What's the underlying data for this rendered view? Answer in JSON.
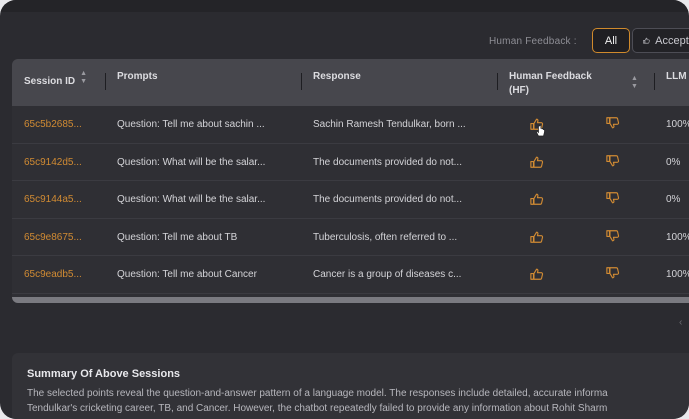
{
  "filter": {
    "label": "Human Feedback :",
    "options": [
      "All",
      "Accepted"
    ]
  },
  "table": {
    "headers": {
      "session_id": "Session ID",
      "prompts": "Prompts",
      "response": "Response",
      "human_feedback_line1": "Human Feedback",
      "human_feedback_line2": "(HF)",
      "llm": "LLM"
    },
    "rows": [
      {
        "session_id": "65c5b2685...",
        "prompt": "Question: Tell me about sachin ...",
        "response": "Sachin Ramesh Tendulkar, born ...",
        "llm": "100%"
      },
      {
        "session_id": "65c9142d5...",
        "prompt": "Question: What will be the salar...",
        "response": "The documents provided do not...",
        "llm": "0%"
      },
      {
        "session_id": "65c9144a5...",
        "prompt": "Question: What will be the salar...",
        "response": "The documents provided do not...",
        "llm": "0%"
      },
      {
        "session_id": "65c9e8675...",
        "prompt": "Question: Tell me about TB",
        "response": "Tuberculosis, often referred to ...",
        "llm": "100%"
      },
      {
        "session_id": "65c9eadb5...",
        "prompt": "Question: Tell me about Cancer",
        "response": "Cancer is a group of diseases c...",
        "llm": "100%"
      }
    ]
  },
  "summary": {
    "title": "Summary Of Above Sessions",
    "line1": "The selected points reveal the question-and-answer pattern of a language model. The responses include detailed, accurate informa",
    "line2": "Tendulkar's cricketing career, TB, and Cancer. However, the chatbot repeatedly failed to provide any information about Rohit Sharm"
  },
  "colors": {
    "accent": "#d18b33",
    "background": "#2b2b30",
    "header": "#47474d"
  },
  "icons": {
    "thumbs_up": "thumbs-up-icon",
    "thumbs_down": "thumbs-down-icon",
    "sort": "sort-icon"
  }
}
